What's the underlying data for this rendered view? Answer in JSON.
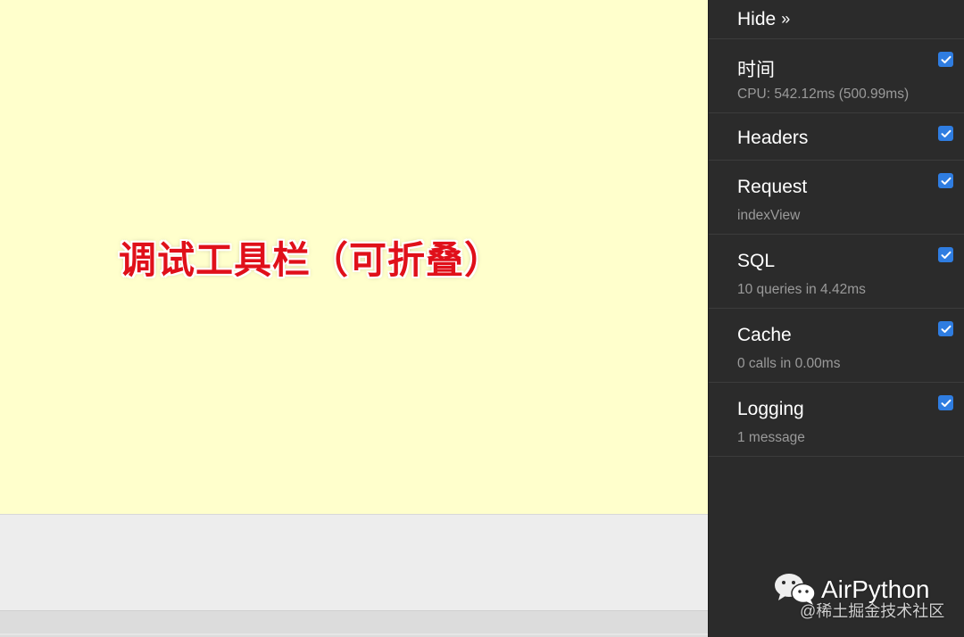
{
  "content": {
    "annotation": "调试工具栏（可折叠）"
  },
  "toolbar": {
    "hide_label": "Hide",
    "hide_icon": "double-chevron-right-icon",
    "panels": [
      {
        "title": "时间",
        "subtitle": "CPU: 542.12ms (500.99ms)",
        "checked": true
      },
      {
        "title": "Headers",
        "subtitle": "",
        "checked": true
      },
      {
        "title": "Request",
        "subtitle": "indexView",
        "checked": true
      },
      {
        "title": "SQL",
        "subtitle": "10 queries in 4.42ms",
        "checked": true
      },
      {
        "title": "Cache",
        "subtitle": "0 calls in 0.00ms",
        "checked": true
      },
      {
        "title": "Logging",
        "subtitle": "1 message",
        "checked": true
      }
    ]
  },
  "watermark": {
    "name": "AirPython",
    "sub": "@稀土掘金技术社区",
    "logo_icon": "wechat-logo-icon"
  },
  "colors": {
    "content_bg": "#ffffcc",
    "toolbar_bg": "#2b2b2b",
    "checkbox": "#2f7de1",
    "annotation": "#e0101a"
  }
}
